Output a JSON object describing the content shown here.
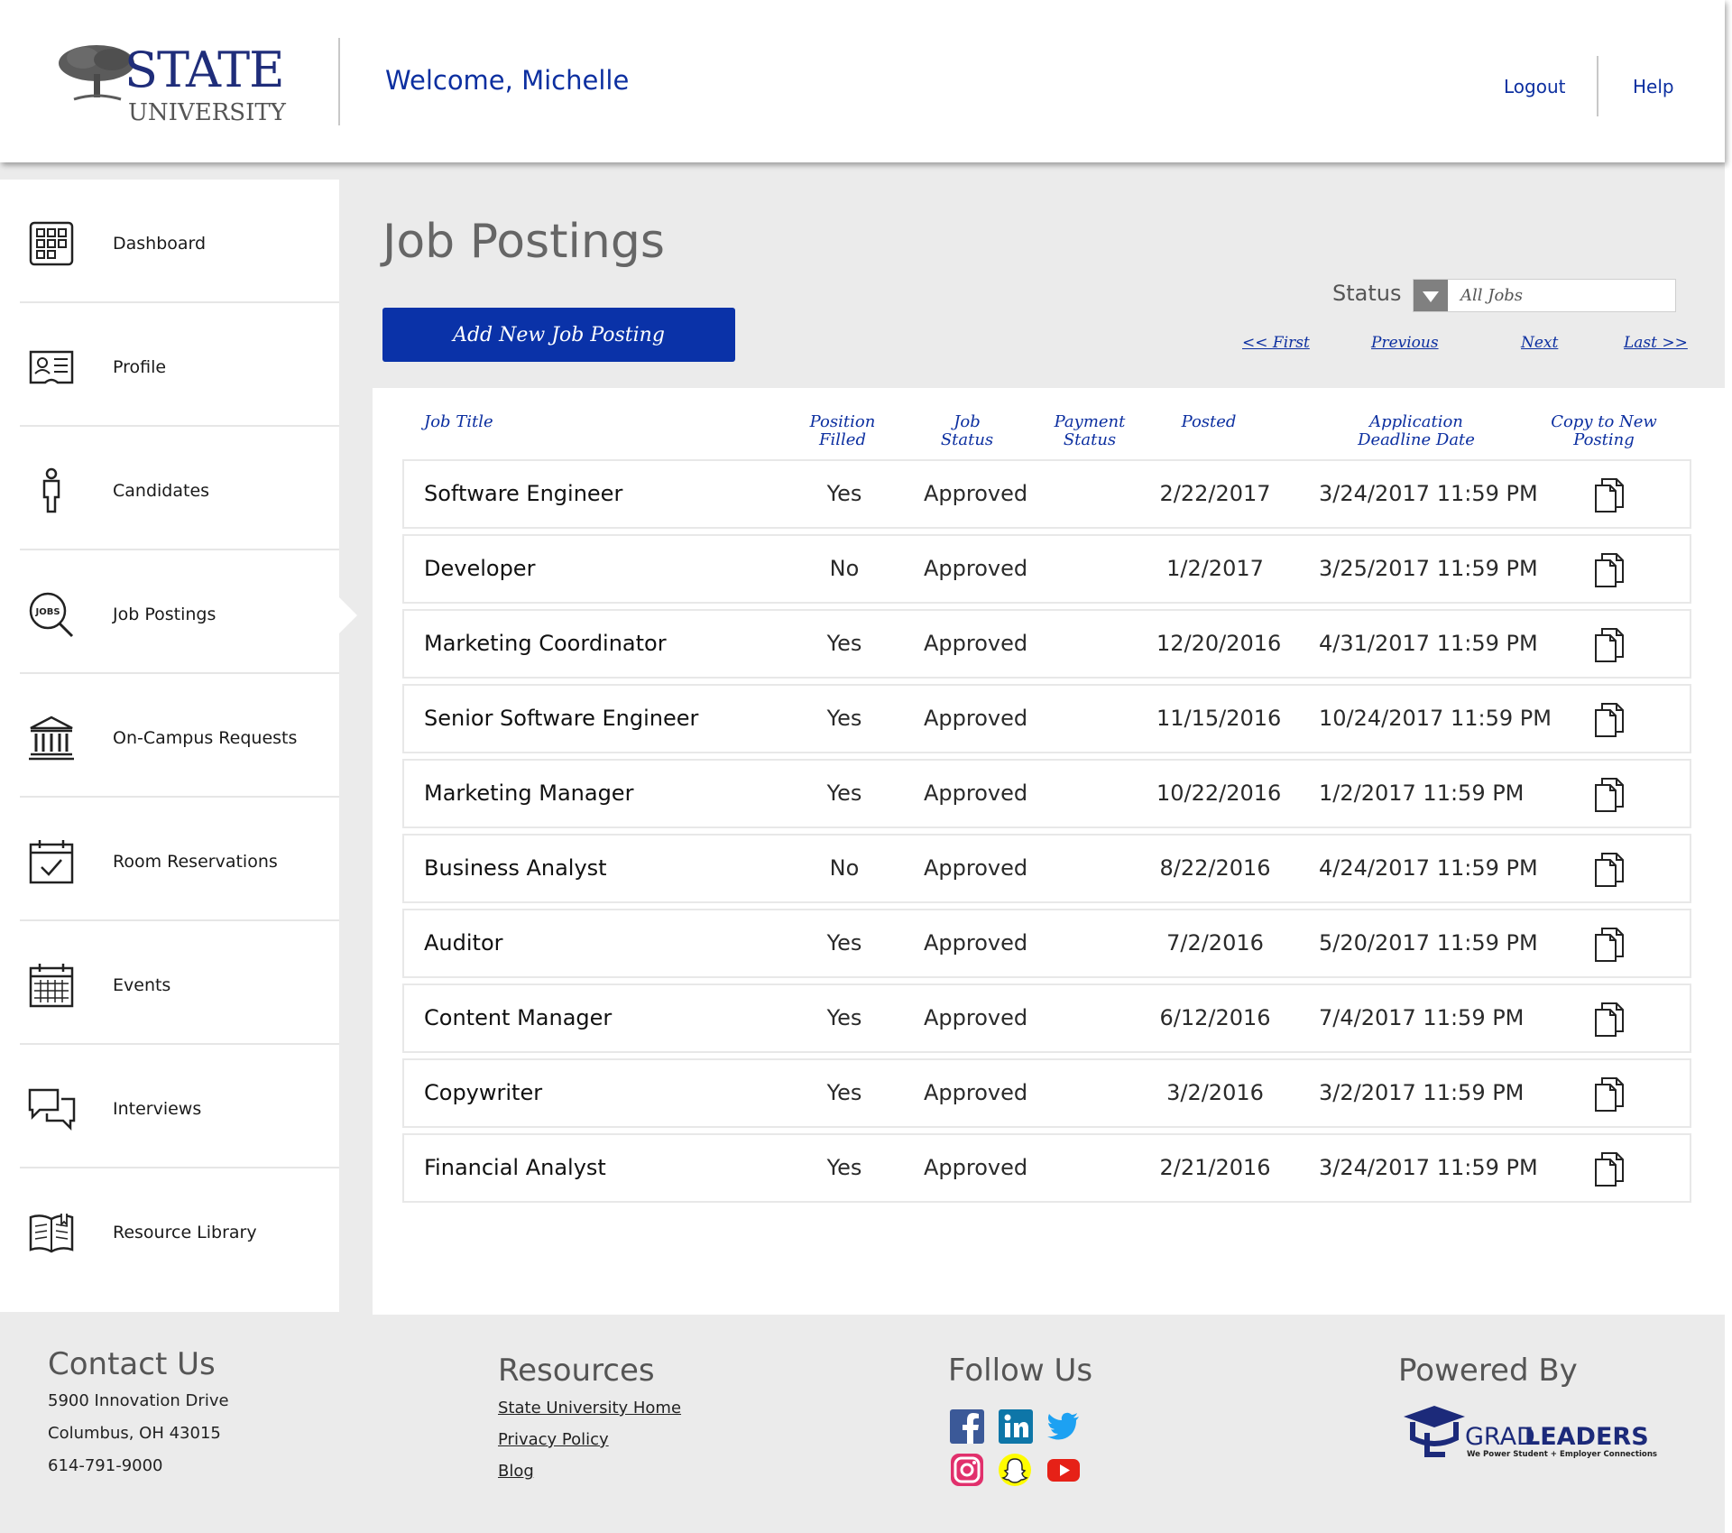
{
  "header": {
    "logo_state": "STATE",
    "logo_university": "UNIVERSITY",
    "welcome": "Welcome, Michelle",
    "logout": "Logout",
    "help": "Help"
  },
  "sidebar": {
    "items": [
      {
        "label": "Dashboard",
        "icon": "dashboard-grid-icon"
      },
      {
        "label": "Profile",
        "icon": "id-card-icon"
      },
      {
        "label": "Candidates",
        "icon": "person-icon"
      },
      {
        "label": "Job Postings",
        "icon": "jobs-magnifier-icon",
        "active": true
      },
      {
        "label": "On-Campus Requests",
        "icon": "campus-building-icon"
      },
      {
        "label": "Room Reservations",
        "icon": "calendar-check-icon"
      },
      {
        "label": "Events",
        "icon": "calendar-grid-icon"
      },
      {
        "label": "Interviews",
        "icon": "chat-bubbles-icon"
      },
      {
        "label": "Resource Library",
        "icon": "open-book-icon"
      }
    ]
  },
  "main": {
    "title": "Job Postings",
    "add_button": "Add New Job Posting",
    "status_label": "Status",
    "status_value": "All Jobs",
    "pager": {
      "first": "<< First",
      "previous": "Previous",
      "next": "Next",
      "last": "Last >>"
    },
    "columns": {
      "job_title": "Job Title",
      "position_filled_1": "Position",
      "position_filled_2": "Filled",
      "job_status_1": "Job",
      "job_status_2": "Status",
      "payment_status_1": "Payment",
      "payment_status_2": "Status",
      "posted": "Posted",
      "deadline_1": "Application",
      "deadline_2": "Deadline Date",
      "copy_1": "Copy to New",
      "copy_2": "Posting"
    },
    "rows": [
      {
        "title": "Software Engineer",
        "filled": "Yes",
        "status": "Approved",
        "payment": "",
        "posted": "2/22/2017",
        "deadline": "3/24/2017 11:59 PM"
      },
      {
        "title": "Developer",
        "filled": "No",
        "status": "Approved",
        "payment": "",
        "posted": "1/2/2017",
        "deadline": "3/25/2017 11:59 PM"
      },
      {
        "title": "Marketing Coordinator",
        "filled": "Yes",
        "status": "Approved",
        "payment": "",
        "posted": "12/20/2016",
        "deadline": "4/31/2017 11:59 PM"
      },
      {
        "title": "Senior Software Engineer",
        "filled": "Yes",
        "status": "Approved",
        "payment": "",
        "posted": "11/15/2016",
        "deadline": "10/24/2017 11:59 PM"
      },
      {
        "title": "Marketing Manager",
        "filled": "Yes",
        "status": "Approved",
        "payment": "",
        "posted": "10/22/2016",
        "deadline": "1/2/2017 11:59 PM"
      },
      {
        "title": "Business Analyst",
        "filled": "No",
        "status": "Approved",
        "payment": "",
        "posted": "8/22/2016",
        "deadline": "4/24/2017 11:59 PM"
      },
      {
        "title": "Auditor",
        "filled": "Yes",
        "status": "Approved",
        "payment": "",
        "posted": "7/2/2016",
        "deadline": "5/20/2017 11:59 PM"
      },
      {
        "title": "Content Manager",
        "filled": "Yes",
        "status": "Approved",
        "payment": "",
        "posted": "6/12/2016",
        "deadline": "7/4/2017 11:59 PM"
      },
      {
        "title": "Copywriter",
        "filled": "Yes",
        "status": "Approved",
        "payment": "",
        "posted": "3/2/2016",
        "deadline": "3/2/2017 11:59 PM"
      },
      {
        "title": "Financial Analyst",
        "filled": "Yes",
        "status": "Approved",
        "payment": "",
        "posted": "2/21/2016",
        "deadline": "3/24/2017 11:59 PM"
      }
    ]
  },
  "footer": {
    "contact": {
      "heading": "Contact Us",
      "address1": "5900 Innovation Drive",
      "address2": "Columbus, OH 43015",
      "phone": "614-791-9000"
    },
    "resources": {
      "heading": "Resources",
      "links": [
        "State University Home",
        "Privacy Policy",
        "Blog"
      ]
    },
    "follow": {
      "heading": "Follow Us",
      "icons": [
        "facebook-icon",
        "linkedin-icon",
        "twitter-icon",
        "instagram-icon",
        "snapchat-icon",
        "youtube-icon"
      ]
    },
    "powered": {
      "heading": "Powered By",
      "logo_grad": "GRAD",
      "logo_leaders": "LEADERS",
      "logo_tagline": "We Power Student + Employer Connections"
    }
  },
  "colors": {
    "brand_blue": "#0a32a8",
    "link_blue": "#0c2fa0",
    "frame_grey": "#ebebeb"
  }
}
